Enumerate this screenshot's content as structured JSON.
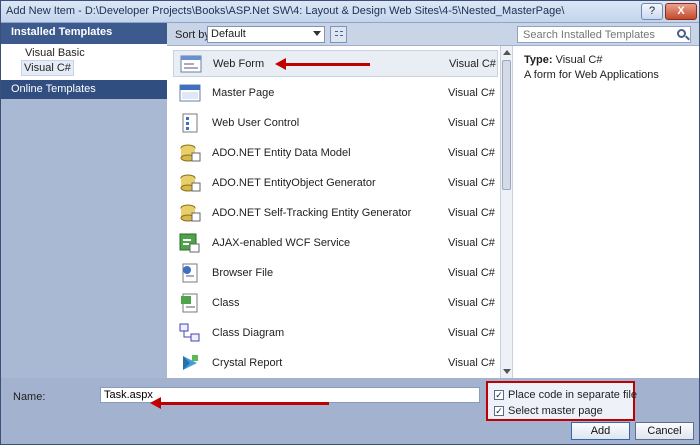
{
  "window": {
    "title": "Add New Item - D:\\Developer Projects\\Books\\ASP.Net SW\\4: Layout & Design Web Sites\\4-5\\Nested_MasterPage\\",
    "help_label": "?",
    "close_label": "X"
  },
  "sidebar": {
    "installed_header": "Installed Templates",
    "items": [
      {
        "label": "Visual Basic"
      },
      {
        "label": "Visual C#"
      }
    ],
    "online_header": "Online Templates"
  },
  "toolbar": {
    "sort_label": "Sort by:",
    "sort_value": "Default"
  },
  "search": {
    "placeholder": "Search Installed Templates"
  },
  "templates": [
    {
      "name": "Web Form",
      "lang": "Visual C#",
      "icon": "web-form-icon"
    },
    {
      "name": "Master Page",
      "lang": "Visual C#",
      "icon": "master-page-icon"
    },
    {
      "name": "Web User Control",
      "lang": "Visual C#",
      "icon": "user-control-icon"
    },
    {
      "name": "ADO.NET Entity Data Model",
      "lang": "Visual C#",
      "icon": "entity-model-icon"
    },
    {
      "name": "ADO.NET EntityObject Generator",
      "lang": "Visual C#",
      "icon": "entity-generator-icon"
    },
    {
      "name": "ADO.NET Self-Tracking Entity Generator",
      "lang": "Visual C#",
      "icon": "self-tracking-icon"
    },
    {
      "name": "AJAX-enabled WCF Service",
      "lang": "Visual C#",
      "icon": "wcf-service-icon"
    },
    {
      "name": "Browser File",
      "lang": "Visual C#",
      "icon": "browser-file-icon"
    },
    {
      "name": "Class",
      "lang": "Visual C#",
      "icon": "class-icon"
    },
    {
      "name": "Class Diagram",
      "lang": "Visual C#",
      "icon": "class-diagram-icon"
    },
    {
      "name": "Crystal Report",
      "lang": "Visual C#",
      "icon": "crystal-report-icon"
    }
  ],
  "details": {
    "type_label": "Type:",
    "type_value": "Visual C#",
    "description": "A form for Web Applications"
  },
  "bottom": {
    "name_label": "Name:",
    "name_value": "Task.aspx",
    "option_code_separate": "Place code in separate file",
    "option_master_page": "Select master page",
    "check_mark": "✓",
    "add_label": "Add",
    "cancel_label": "Cancel"
  },
  "colors": {
    "annotation": "#c00000",
    "header": "#3d5a8e",
    "frame": "#a3b3cf"
  }
}
